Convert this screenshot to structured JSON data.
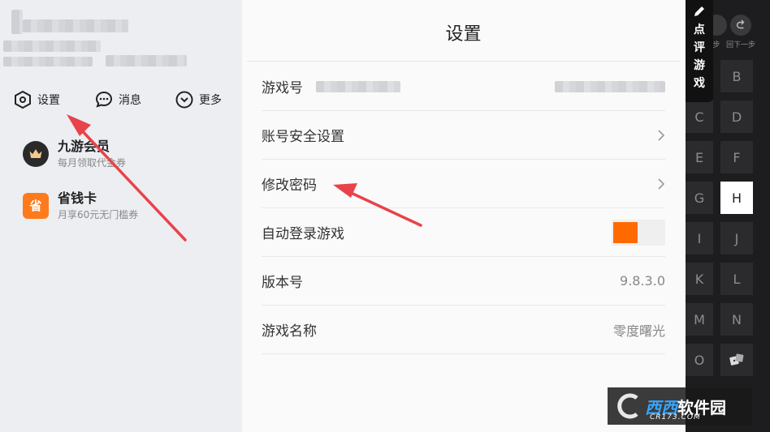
{
  "left_panel": {
    "quick_actions": [
      {
        "label": "设置",
        "icon": "settings-hexagon-icon"
      },
      {
        "label": "消息",
        "icon": "chat-bubble-icon"
      },
      {
        "label": "更多",
        "icon": "chevron-down-circle-icon"
      }
    ],
    "menu": [
      {
        "title": "九游会员",
        "subtitle": "每月领取代金券",
        "icon": "crown-icon",
        "icon_color": "#2a2a2a"
      },
      {
        "title": "省钱卡",
        "subtitle": "月享60元无门槛券",
        "icon": "savings-card-icon",
        "icon_color": "#ff7a1a",
        "icon_text": "省"
      }
    ]
  },
  "settings": {
    "title": "设置",
    "rows": [
      {
        "label": "游戏号",
        "value": "",
        "type": "blurred"
      },
      {
        "label": "账号安全设置",
        "type": "chevron"
      },
      {
        "label": "修改密码",
        "type": "chevron"
      },
      {
        "label": "自动登录游戏",
        "type": "toggle",
        "on": true
      },
      {
        "label": "版本号",
        "value": "9.8.3.0",
        "type": "value"
      },
      {
        "label": "游戏名称",
        "value": "零度曙光",
        "type": "value"
      }
    ]
  },
  "keyboard": {
    "review_label": "点评游戏",
    "top_tools": [
      "步",
      "回下一步"
    ],
    "keys": [
      "B",
      "C",
      "D",
      "E",
      "F",
      "G",
      "H",
      "I",
      "J",
      "K",
      "L",
      "M",
      "N",
      "O"
    ],
    "active_key": "H",
    "extra_icon": "dice-icon"
  },
  "watermark": {
    "text_a": "西西",
    "text_b": "软件园",
    "url": "CR173.COM"
  },
  "colors": {
    "accent": "#ff6a00",
    "arrow": "#e8434a",
    "keyboard_bg": "#1d1d1f"
  }
}
